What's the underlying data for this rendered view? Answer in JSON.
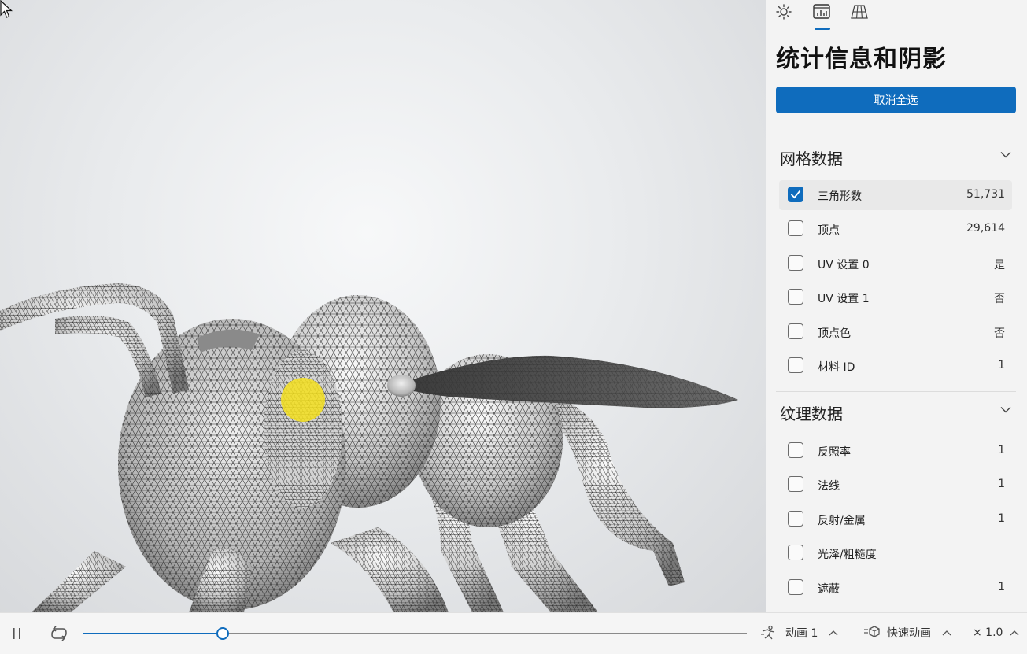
{
  "panel": {
    "tabs": [
      {
        "name": "lighting",
        "icon": "sun-icon"
      },
      {
        "name": "stats",
        "icon": "stats-icon",
        "active": true
      },
      {
        "name": "grid",
        "icon": "grid-floor-icon"
      }
    ],
    "title": "统计信息和阴影",
    "deselect_label": "取消全选",
    "accent_color": "#0f6cbd",
    "sections": [
      {
        "title": "网格数据",
        "rows": [
          {
            "label": "三角形数",
            "value": "51,731",
            "checked": true
          },
          {
            "label": "顶点",
            "value": "29,614",
            "checked": false
          },
          {
            "label": "UV 设置 0",
            "value": "是",
            "checked": false
          },
          {
            "label": "UV 设置 1",
            "value": "否",
            "checked": false
          },
          {
            "label": "顶点色",
            "value": "否",
            "checked": false
          },
          {
            "label": "材料 ID",
            "value": "1",
            "checked": false
          }
        ]
      },
      {
        "title": "纹理数据",
        "rows": [
          {
            "label": "反照率",
            "value": "1",
            "checked": false
          },
          {
            "label": "法线",
            "value": "1",
            "checked": false
          },
          {
            "label": "反射/金属",
            "value": "1",
            "checked": false
          },
          {
            "label": "光泽/粗糙度",
            "value": "",
            "checked": false
          },
          {
            "label": "遮蔽",
            "value": "1",
            "checked": false
          }
        ]
      }
    ]
  },
  "playback": {
    "progress": 0.21,
    "animation_label": "动画 1",
    "quick_anim_label": "快速动画",
    "speed_label": "× 1.0"
  }
}
